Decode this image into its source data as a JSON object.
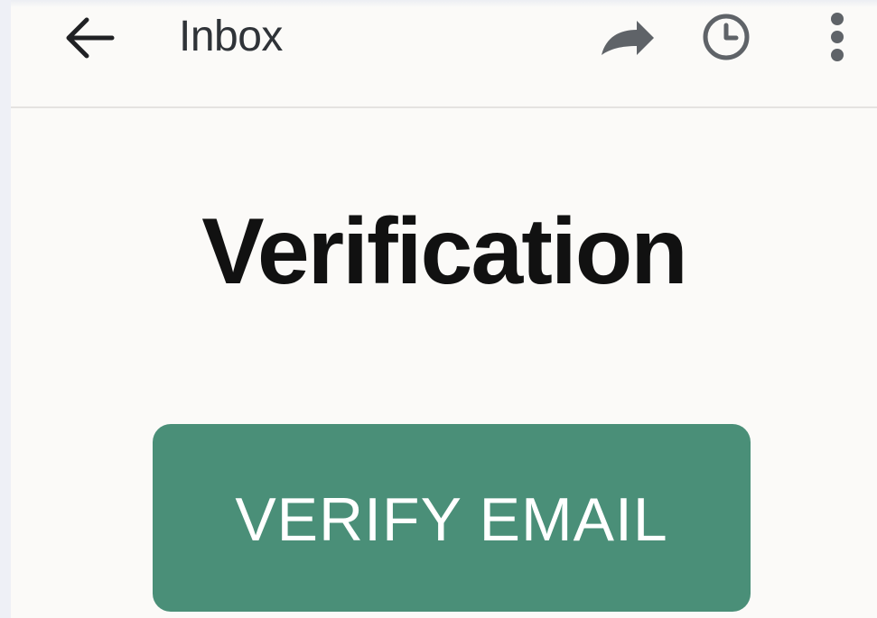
{
  "app": {
    "header": {
      "title": "Inbox",
      "icons": {
        "back": "back-arrow-icon",
        "forward": "forward-icon",
        "history": "clock-icon",
        "more": "more-vertical-icon"
      }
    },
    "main": {
      "heading": "Verification",
      "primary_button_label": "VERIFY EMAIL"
    },
    "colors": {
      "accent": "#4a8f78",
      "icon": "#5f6368",
      "text": "#111111",
      "background": "#fbfaf8"
    }
  }
}
